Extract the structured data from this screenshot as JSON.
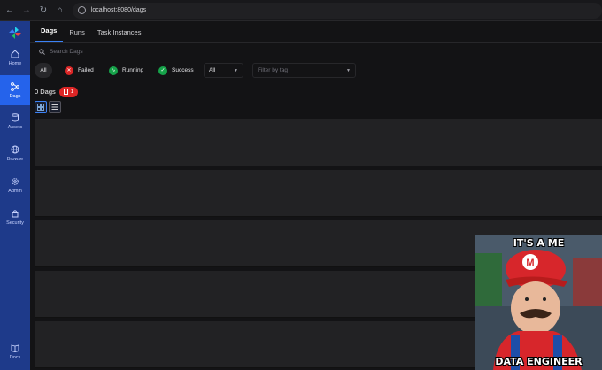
{
  "browser": {
    "url": "localhost:8080/dags",
    "icons": [
      "back-icon",
      "forward-icon",
      "reload-icon",
      "home-icon",
      "info-icon"
    ]
  },
  "sidebar": {
    "items": [
      {
        "label": "Home",
        "icon": "home-icon",
        "active": false
      },
      {
        "label": "Dags",
        "icon": "dags-icon",
        "active": true
      },
      {
        "label": "Assets",
        "icon": "database-icon",
        "active": false
      },
      {
        "label": "Browse",
        "icon": "globe-icon",
        "active": false
      },
      {
        "label": "Admin",
        "icon": "gear-icon",
        "active": false
      },
      {
        "label": "Security",
        "icon": "lock-icon",
        "active": false
      },
      {
        "label": "Docs",
        "icon": "book-icon",
        "active": false
      }
    ]
  },
  "tabs": [
    {
      "label": "Dags",
      "active": true
    },
    {
      "label": "Runs",
      "active": false
    },
    {
      "label": "Task Instances",
      "active": false
    }
  ],
  "search": {
    "placeholder": "Search Dags"
  },
  "filters": {
    "all": "All",
    "failed": "Failed",
    "running": "Running",
    "success": "Success",
    "state_select": "All",
    "tag_placeholder": "Filter by tag"
  },
  "summary": {
    "count_label": "0 Dags",
    "error_badge": "1"
  },
  "meme": {
    "top_text": "IT'S A ME",
    "bottom_text": "DATA ENGINEER"
  },
  "colors": {
    "sidebar": "#1e3a8a",
    "active": "#2563eb",
    "failed": "#dc2626",
    "running": "#16a34a",
    "success": "#16a34a"
  }
}
